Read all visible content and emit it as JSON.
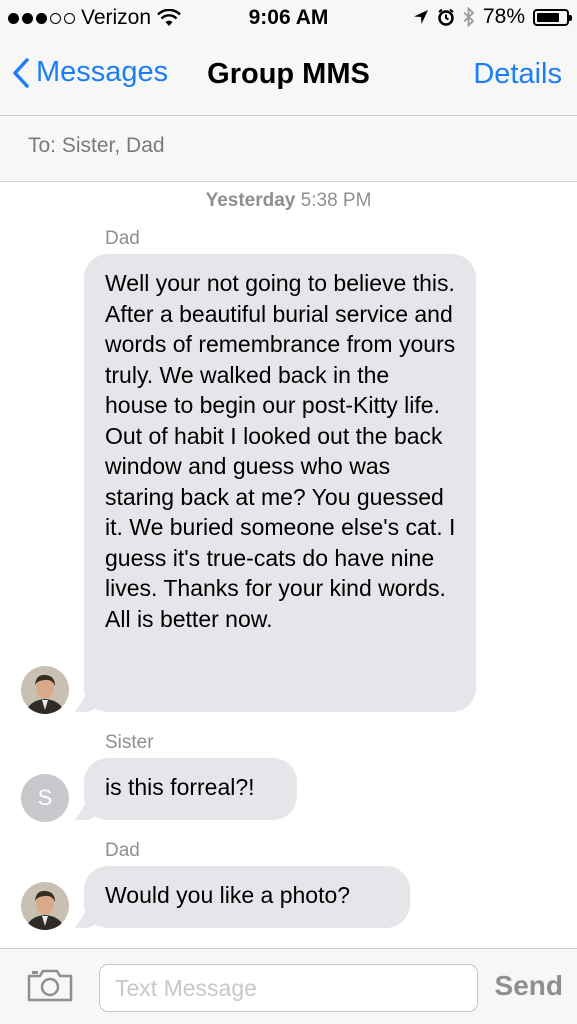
{
  "status_bar": {
    "carrier": "Verizon",
    "time": "9:06 AM",
    "battery_percent": "78%",
    "battery_level": 0.78,
    "signal_bars_filled": 3,
    "signal_bars_total": 5
  },
  "nav": {
    "back_label": "Messages",
    "title": "Group MMS",
    "details_label": "Details"
  },
  "to_bar": {
    "label": "To:",
    "recipients": "Sister, Dad"
  },
  "timestamp": {
    "day": "Yesterday",
    "time": "5:38 PM"
  },
  "messages": [
    {
      "sender": "Dad",
      "text": "Well your not going to believe this. After a beautiful burial service and words of remembrance from yours truly. We walked back in the house to begin our post-Kitty life.  Out of habit I looked out the back window and guess who was staring back at me? You guessed it. We buried someone else's cat. I guess it's true-cats do have nine lives. Thanks for your kind words. All is better now."
    },
    {
      "sender": "Sister",
      "avatar_letter": "S",
      "text": "is this forreal?!"
    },
    {
      "sender": "Dad",
      "text": "Would you like a photo?"
    }
  ],
  "input_bar": {
    "placeholder": "Text Message",
    "send_label": "Send"
  },
  "colors": {
    "accent": "#1a7ef5",
    "bubble_gray": "#e5e5ea",
    "secondary_text": "#8e8e93"
  },
  "icons": [
    "wifi-icon",
    "location-arrow-icon",
    "alarm-icon",
    "bluetooth-icon",
    "battery-icon",
    "back-chevron-icon",
    "camera-icon"
  ]
}
